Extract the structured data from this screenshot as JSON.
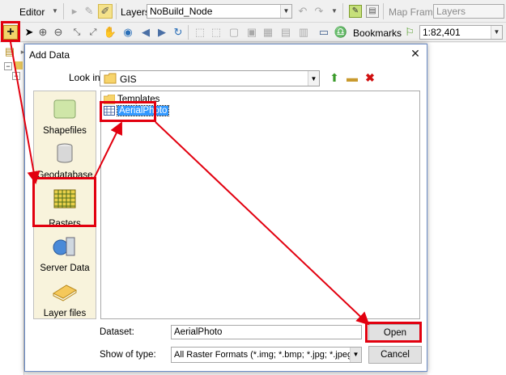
{
  "toolbar_top": {
    "editor_label": "Editor",
    "layers_label": "Layers",
    "layers_value": "NoBuild_Node",
    "map_frame_label": "Map Frame",
    "map_frame_value": "Layers"
  },
  "toolbar_tools": {
    "bookmarks_label": "Bookmarks",
    "scale_value": "1:82,401"
  },
  "dialog": {
    "title": "Add Data",
    "close_glyph": "✕",
    "look_in_label": "Look in:",
    "look_in_value": "GIS",
    "sidebar": [
      {
        "label": "Shapefiles",
        "icon": "shapefiles-icon"
      },
      {
        "label": "Geodatabase",
        "icon": "geodatabase-icon"
      },
      {
        "label": "Rasters",
        "icon": "rasters-icon"
      },
      {
        "label": "Server Data",
        "icon": "server-data-icon"
      },
      {
        "label": "Layer files",
        "icon": "layer-files-icon"
      }
    ],
    "files": [
      {
        "name": "Templates",
        "type": "folder"
      },
      {
        "name": "AerialPhoto",
        "type": "raster"
      }
    ],
    "dataset_label": "Dataset:",
    "dataset_value": "AerialPhoto",
    "show_type_label": "Show of type:",
    "show_type_value": "All Raster Formats (*.img; *.bmp; *.jpg; *.jpeg; *.p...",
    "open_label": "Open",
    "cancel_label": "Cancel"
  },
  "colors": {
    "highlight_red": "#e2000f",
    "selection_blue": "#3399ff",
    "sidebar_bg": "#f8f3dc"
  }
}
